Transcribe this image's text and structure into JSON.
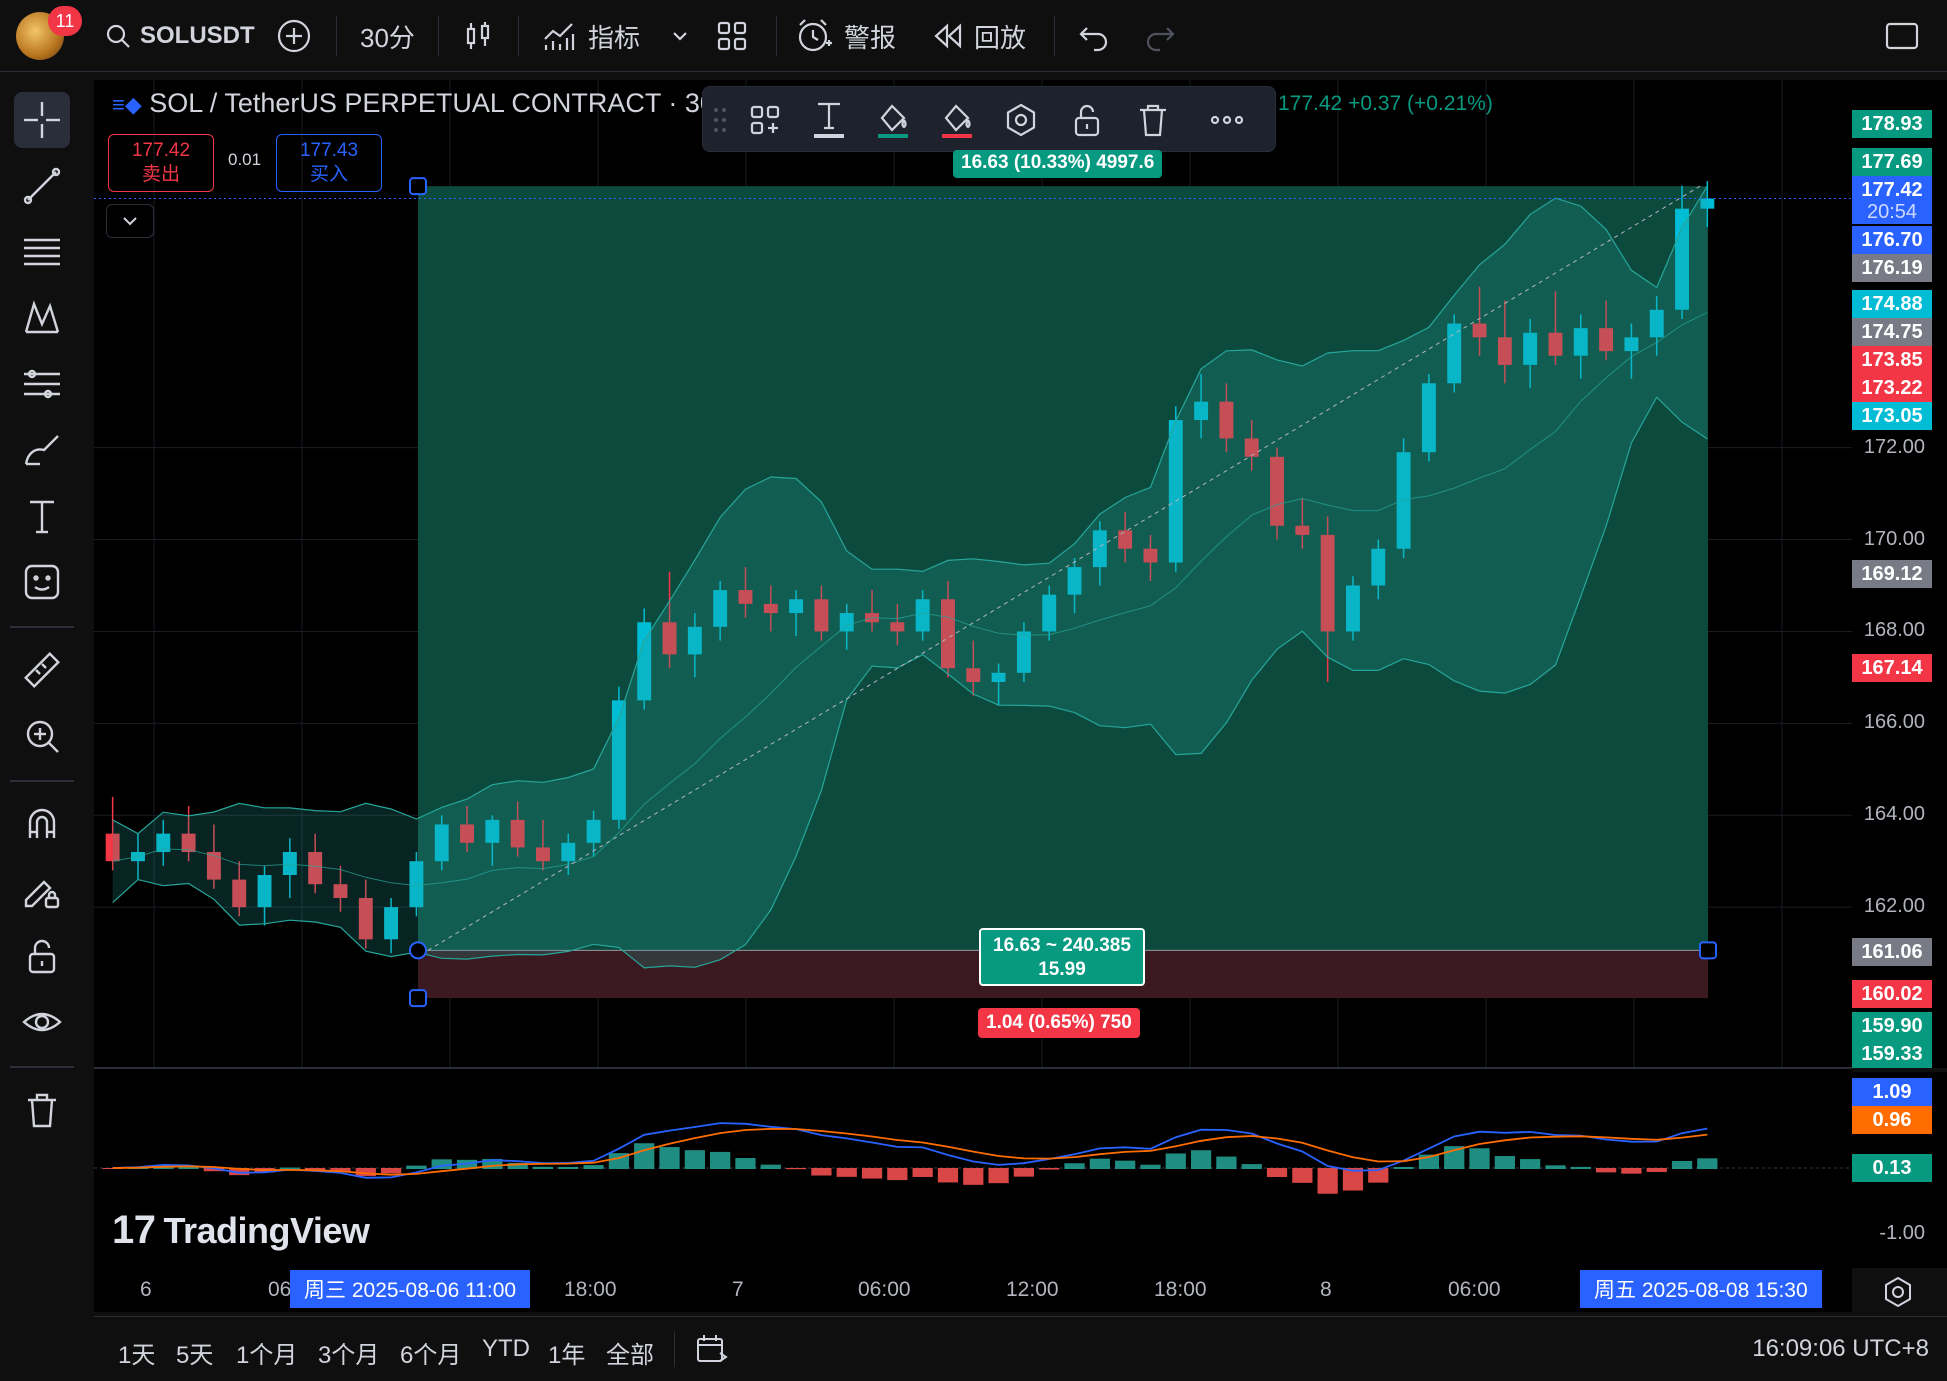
{
  "header": {
    "avatar_badge": "11",
    "symbol": "SOLUSDT",
    "interval": "30分",
    "indicators_label": "指标",
    "alert_label": "警报",
    "replay_label": "回放"
  },
  "symbol_bar": {
    "title": "SOL / TetherUS PERPETUAL CONTRACT · 30 ·",
    "change": "177.42  +0.37 (+0.21%)",
    "sell_price": "177.42",
    "sell_label": "卖出",
    "spread": "0.01",
    "buy_price": "177.43",
    "buy_label": "买入"
  },
  "position_tool": {
    "target_label": "16.63 (10.33%) 4997.6",
    "mid_line1": "16.63 ~ 240.385",
    "mid_line2": "15.99",
    "stop_label": "1.04 (0.65%) 750"
  },
  "price_axis": {
    "ticks": [
      "172.00",
      "170.00",
      "168.00",
      "166.00",
      "164.00",
      "162.00"
    ],
    "tags": [
      {
        "text": "178.93",
        "color": "#089981"
      },
      {
        "text": "177.69",
        "color": "#089981"
      },
      {
        "text": "177.42",
        "color": "#2962ff"
      },
      {
        "text": "20:54",
        "color": "#2962ff"
      },
      {
        "text": "176.70",
        "color": "#2962ff"
      },
      {
        "text": "176.19",
        "color": "#787b86"
      },
      {
        "text": "174.88",
        "color": "#00bcd4"
      },
      {
        "text": "174.75",
        "color": "#787b86"
      },
      {
        "text": "173.85",
        "color": "#f23645"
      },
      {
        "text": "173.22",
        "color": "#f23645"
      },
      {
        "text": "173.05",
        "color": "#00bcd4"
      },
      {
        "text": "169.12",
        "color": "#787b86"
      },
      {
        "text": "167.14",
        "color": "#f23645"
      },
      {
        "text": "161.06",
        "color": "#787b86"
      },
      {
        "text": "160.02",
        "color": "#f23645"
      },
      {
        "text": "159.90",
        "color": "#089981"
      },
      {
        "text": "159.33",
        "color": "#089981"
      }
    ]
  },
  "macd_axis": {
    "tags": [
      {
        "text": "1.09",
        "color": "#2962ff"
      },
      {
        "text": "0.96",
        "color": "#ff6d00"
      },
      {
        "text": "0.13",
        "color": "#089981"
      }
    ],
    "tick": "-1.00"
  },
  "time_axis": {
    "labels": [
      "6",
      "06",
      "18:00",
      "7",
      "06:00",
      "12:00",
      "18:00",
      "8",
      "06:00"
    ],
    "start_highlight": "周三 2025-08-06   11:00",
    "end_highlight": "周五 2025-08-08   15:30"
  },
  "bottom_bar": {
    "ranges": [
      "1天",
      "5天",
      "1个月",
      "3个月",
      "6个月",
      "YTD",
      "1年",
      "全部"
    ],
    "clock": "16:09:06 UTC+8"
  },
  "watermark": "TradingView",
  "colors": {
    "up": "#00bcd4",
    "down": "#f23645",
    "profit_zone": "#0d4a3e",
    "loss_zone": "#3a1a20",
    "bb_fill": "#26a69a",
    "macd_line": "#2962ff",
    "signal_line": "#ff6d00"
  },
  "chart_data": {
    "type": "candlestick",
    "symbol": "SOLUSDT",
    "interval": "30分",
    "ylim": [
      158.5,
      180
    ],
    "y_ticks": [
      162,
      164,
      166,
      168,
      170,
      172
    ],
    "long_position": {
      "entry": 161.06,
      "target": 177.69,
      "stop": 160.02
    },
    "candles": [
      [
        163.6,
        164.4,
        162.8,
        163.0
      ],
      [
        163.0,
        163.6,
        162.6,
        163.2
      ],
      [
        163.2,
        163.9,
        162.9,
        163.6
      ],
      [
        163.6,
        164.2,
        163.0,
        163.2
      ],
      [
        163.2,
        163.8,
        162.4,
        162.6
      ],
      [
        162.6,
        163.0,
        161.8,
        162.0
      ],
      [
        162.0,
        162.9,
        161.6,
        162.7
      ],
      [
        162.7,
        163.5,
        162.2,
        163.2
      ],
      [
        163.2,
        163.6,
        162.3,
        162.5
      ],
      [
        162.5,
        162.9,
        161.9,
        162.2
      ],
      [
        162.2,
        162.6,
        161.1,
        161.3
      ],
      [
        161.3,
        162.2,
        161.0,
        162.0
      ],
      [
        162.0,
        163.2,
        161.8,
        163.0
      ],
      [
        163.0,
        164.0,
        162.8,
        163.8
      ],
      [
        163.8,
        164.2,
        163.2,
        163.4
      ],
      [
        163.4,
        164.0,
        162.9,
        163.9
      ],
      [
        163.9,
        164.3,
        163.1,
        163.3
      ],
      [
        163.3,
        163.9,
        162.8,
        163.0
      ],
      [
        163.0,
        163.6,
        162.7,
        163.4
      ],
      [
        163.4,
        164.1,
        163.1,
        163.9
      ],
      [
        163.9,
        166.8,
        163.7,
        166.5
      ],
      [
        166.5,
        168.5,
        166.3,
        168.2
      ],
      [
        168.2,
        169.3,
        167.2,
        167.5
      ],
      [
        167.5,
        168.4,
        167.0,
        168.1
      ],
      [
        168.1,
        169.1,
        167.8,
        168.9
      ],
      [
        168.9,
        169.4,
        168.3,
        168.6
      ],
      [
        168.6,
        169.0,
        168.0,
        168.4
      ],
      [
        168.4,
        168.9,
        167.9,
        168.7
      ],
      [
        168.7,
        169.0,
        167.8,
        168.0
      ],
      [
        168.0,
        168.6,
        167.6,
        168.4
      ],
      [
        168.4,
        168.9,
        168.0,
        168.2
      ],
      [
        168.2,
        168.6,
        167.7,
        168.0
      ],
      [
        168.0,
        168.9,
        167.8,
        168.7
      ],
      [
        168.7,
        169.1,
        167.0,
        167.2
      ],
      [
        167.2,
        167.8,
        166.6,
        166.9
      ],
      [
        166.9,
        167.3,
        166.4,
        167.1
      ],
      [
        167.1,
        168.2,
        166.9,
        168.0
      ],
      [
        168.0,
        169.0,
        167.8,
        168.8
      ],
      [
        168.8,
        169.6,
        168.4,
        169.4
      ],
      [
        169.4,
        170.4,
        169.0,
        170.2
      ],
      [
        170.2,
        170.6,
        169.5,
        169.8
      ],
      [
        169.8,
        170.1,
        169.1,
        169.5
      ],
      [
        169.5,
        172.9,
        169.3,
        172.6
      ],
      [
        172.6,
        173.6,
        172.2,
        173.0
      ],
      [
        173.0,
        173.4,
        171.9,
        172.2
      ],
      [
        172.2,
        172.6,
        171.5,
        171.8
      ],
      [
        171.8,
        172.0,
        170.0,
        170.3
      ],
      [
        170.3,
        170.9,
        169.8,
        170.1
      ],
      [
        170.1,
        170.5,
        166.9,
        168.0
      ],
      [
        168.0,
        169.2,
        167.8,
        169.0
      ],
      [
        169.0,
        170.0,
        168.7,
        169.8
      ],
      [
        169.8,
        172.2,
        169.6,
        171.9
      ],
      [
        171.9,
        173.6,
        171.7,
        173.4
      ],
      [
        173.4,
        174.9,
        173.2,
        174.7
      ],
      [
        174.7,
        175.5,
        174.0,
        174.4
      ],
      [
        174.4,
        175.2,
        173.4,
        173.8
      ],
      [
        173.8,
        174.8,
        173.3,
        174.5
      ],
      [
        174.5,
        175.4,
        173.8,
        174.0
      ],
      [
        174.0,
        174.9,
        173.5,
        174.6
      ],
      [
        174.6,
        175.2,
        173.9,
        174.1
      ],
      [
        174.1,
        174.7,
        173.5,
        174.4
      ],
      [
        174.4,
        175.3,
        174.0,
        175.0
      ],
      [
        175.0,
        177.7,
        174.8,
        177.2
      ],
      [
        177.2,
        177.8,
        176.8,
        177.42
      ]
    ]
  }
}
